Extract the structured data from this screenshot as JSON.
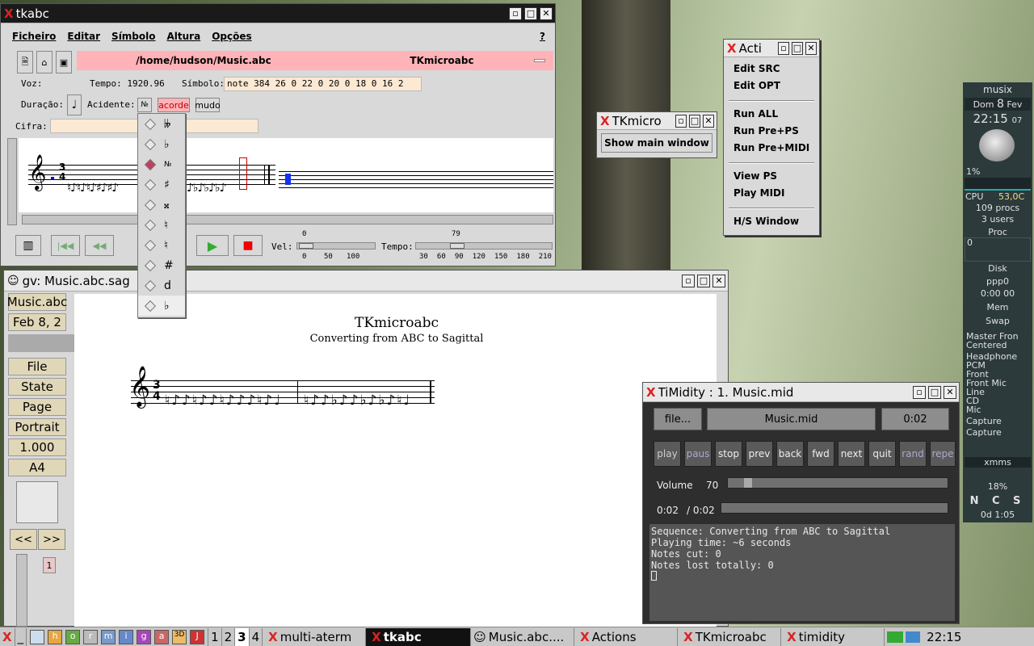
{
  "tkabc": {
    "title": "tkabc",
    "menu": [
      "Ficheiro",
      "Editar",
      "Símbolo",
      "Altura",
      "Opções"
    ],
    "help": "?",
    "filepath": "/home/hudson/Music.abc",
    "app_name": "TKmicroabc",
    "voz_label": "Voz:",
    "tempo_label": "Tempo: 1920.96",
    "simbolo_label": "Símbolo:",
    "simbolo_value": "note 384 26 0 22 0 20 0 18 0 16 2",
    "duracao_label": "Duração:",
    "acidente_label": "Acidente:",
    "acidente_value": "№",
    "acorde_label": "acorde",
    "mudo_label": "mudo",
    "cifra_label": "Cifra:",
    "vel_label": "Vel:",
    "vel_value": "0",
    "vel_ticks": [
      "0",
      "50",
      "100"
    ],
    "tempo_slider_label": "Tempo:",
    "tempo_value": "79",
    "tempo_ticks": [
      "30",
      "60",
      "90",
      "120",
      "150",
      "180",
      "210"
    ]
  },
  "accidentals": [
    "𝄫",
    "♭",
    "№",
    "♯",
    "𝄪",
    "♮",
    "♮",
    "#",
    "d",
    "♭"
  ],
  "actions": {
    "title": "Acti",
    "items": [
      "Edit SRC",
      "Edit OPT",
      "Run ALL",
      "Run Pre+PS",
      "Run Pre+MIDI",
      "View PS",
      "Play MIDI",
      "H/S Window"
    ]
  },
  "tkmicro": {
    "title": "TKmicro",
    "button": "Show main window"
  },
  "gv": {
    "title": "gv: Music.abc.sag",
    "file_label": "Music.abc",
    "date_label": "Feb 8, 2",
    "buttons": [
      "File",
      "State",
      "Page",
      "Portrait",
      "1.000",
      "A4"
    ],
    "nav_prev": "<<",
    "nav_next": ">>",
    "page_num": "1",
    "doc_title": "TKmicroabc",
    "doc_subtitle": "Converting from ABC to Sagittal"
  },
  "timidity": {
    "title": "TiMidity : 1. Music.mid",
    "file_btn": "file...",
    "filename": "Music.mid",
    "time": "0:02",
    "controls": [
      "play",
      "paus",
      "stop",
      "prev",
      "back",
      "fwd",
      "next",
      "quit",
      "rand",
      "repe"
    ],
    "volume_label": "Volume",
    "volume_value": "70",
    "pos_current": "0:02",
    "pos_total": "/ 0:02",
    "console": [
      "Sequence: Converting from ABC to Sagittal",
      "Playing time: ~6 seconds",
      "Notes cut: 0",
      "Notes lost totally: 0"
    ]
  },
  "dock": {
    "host": "musix",
    "day": "Dom",
    "date": "8",
    "month": "Fev",
    "time": "22:15",
    "seconds": "07",
    "cpu_pct": "1%",
    "cpu_label": "CPU",
    "cpu_temp": "53,0C",
    "procs": "109 procs",
    "users": "3 users",
    "proc_label": "Proc",
    "proc_val": "0",
    "disk_label": "Disk",
    "ppp": "ppp0",
    "ppp_time": "0:00 00",
    "mem_label": "Mem",
    "swap_label": "Swap",
    "mixer": [
      "Master Fron",
      "Centered",
      "Headphone",
      "PCM",
      "Front",
      "Front Mic",
      "Line",
      "CD",
      "Mic",
      "Capture",
      "Capture"
    ],
    "xmms": "xmms",
    "battery": "18%",
    "keys": "N C S",
    "uptime": "0d 1:05"
  },
  "taskbar": {
    "desktops": [
      "1",
      "2",
      "3",
      "4"
    ],
    "active_desktop": "3",
    "tasks": [
      "multi-aterm",
      "tkabc",
      "Music.abc....",
      "Actions",
      "TKmicroabc",
      "timidity"
    ],
    "clock": "22:15",
    "launcher_letters": [
      "h",
      "o",
      "r",
      "m",
      "i",
      "g",
      "a",
      "3D",
      "J"
    ]
  }
}
